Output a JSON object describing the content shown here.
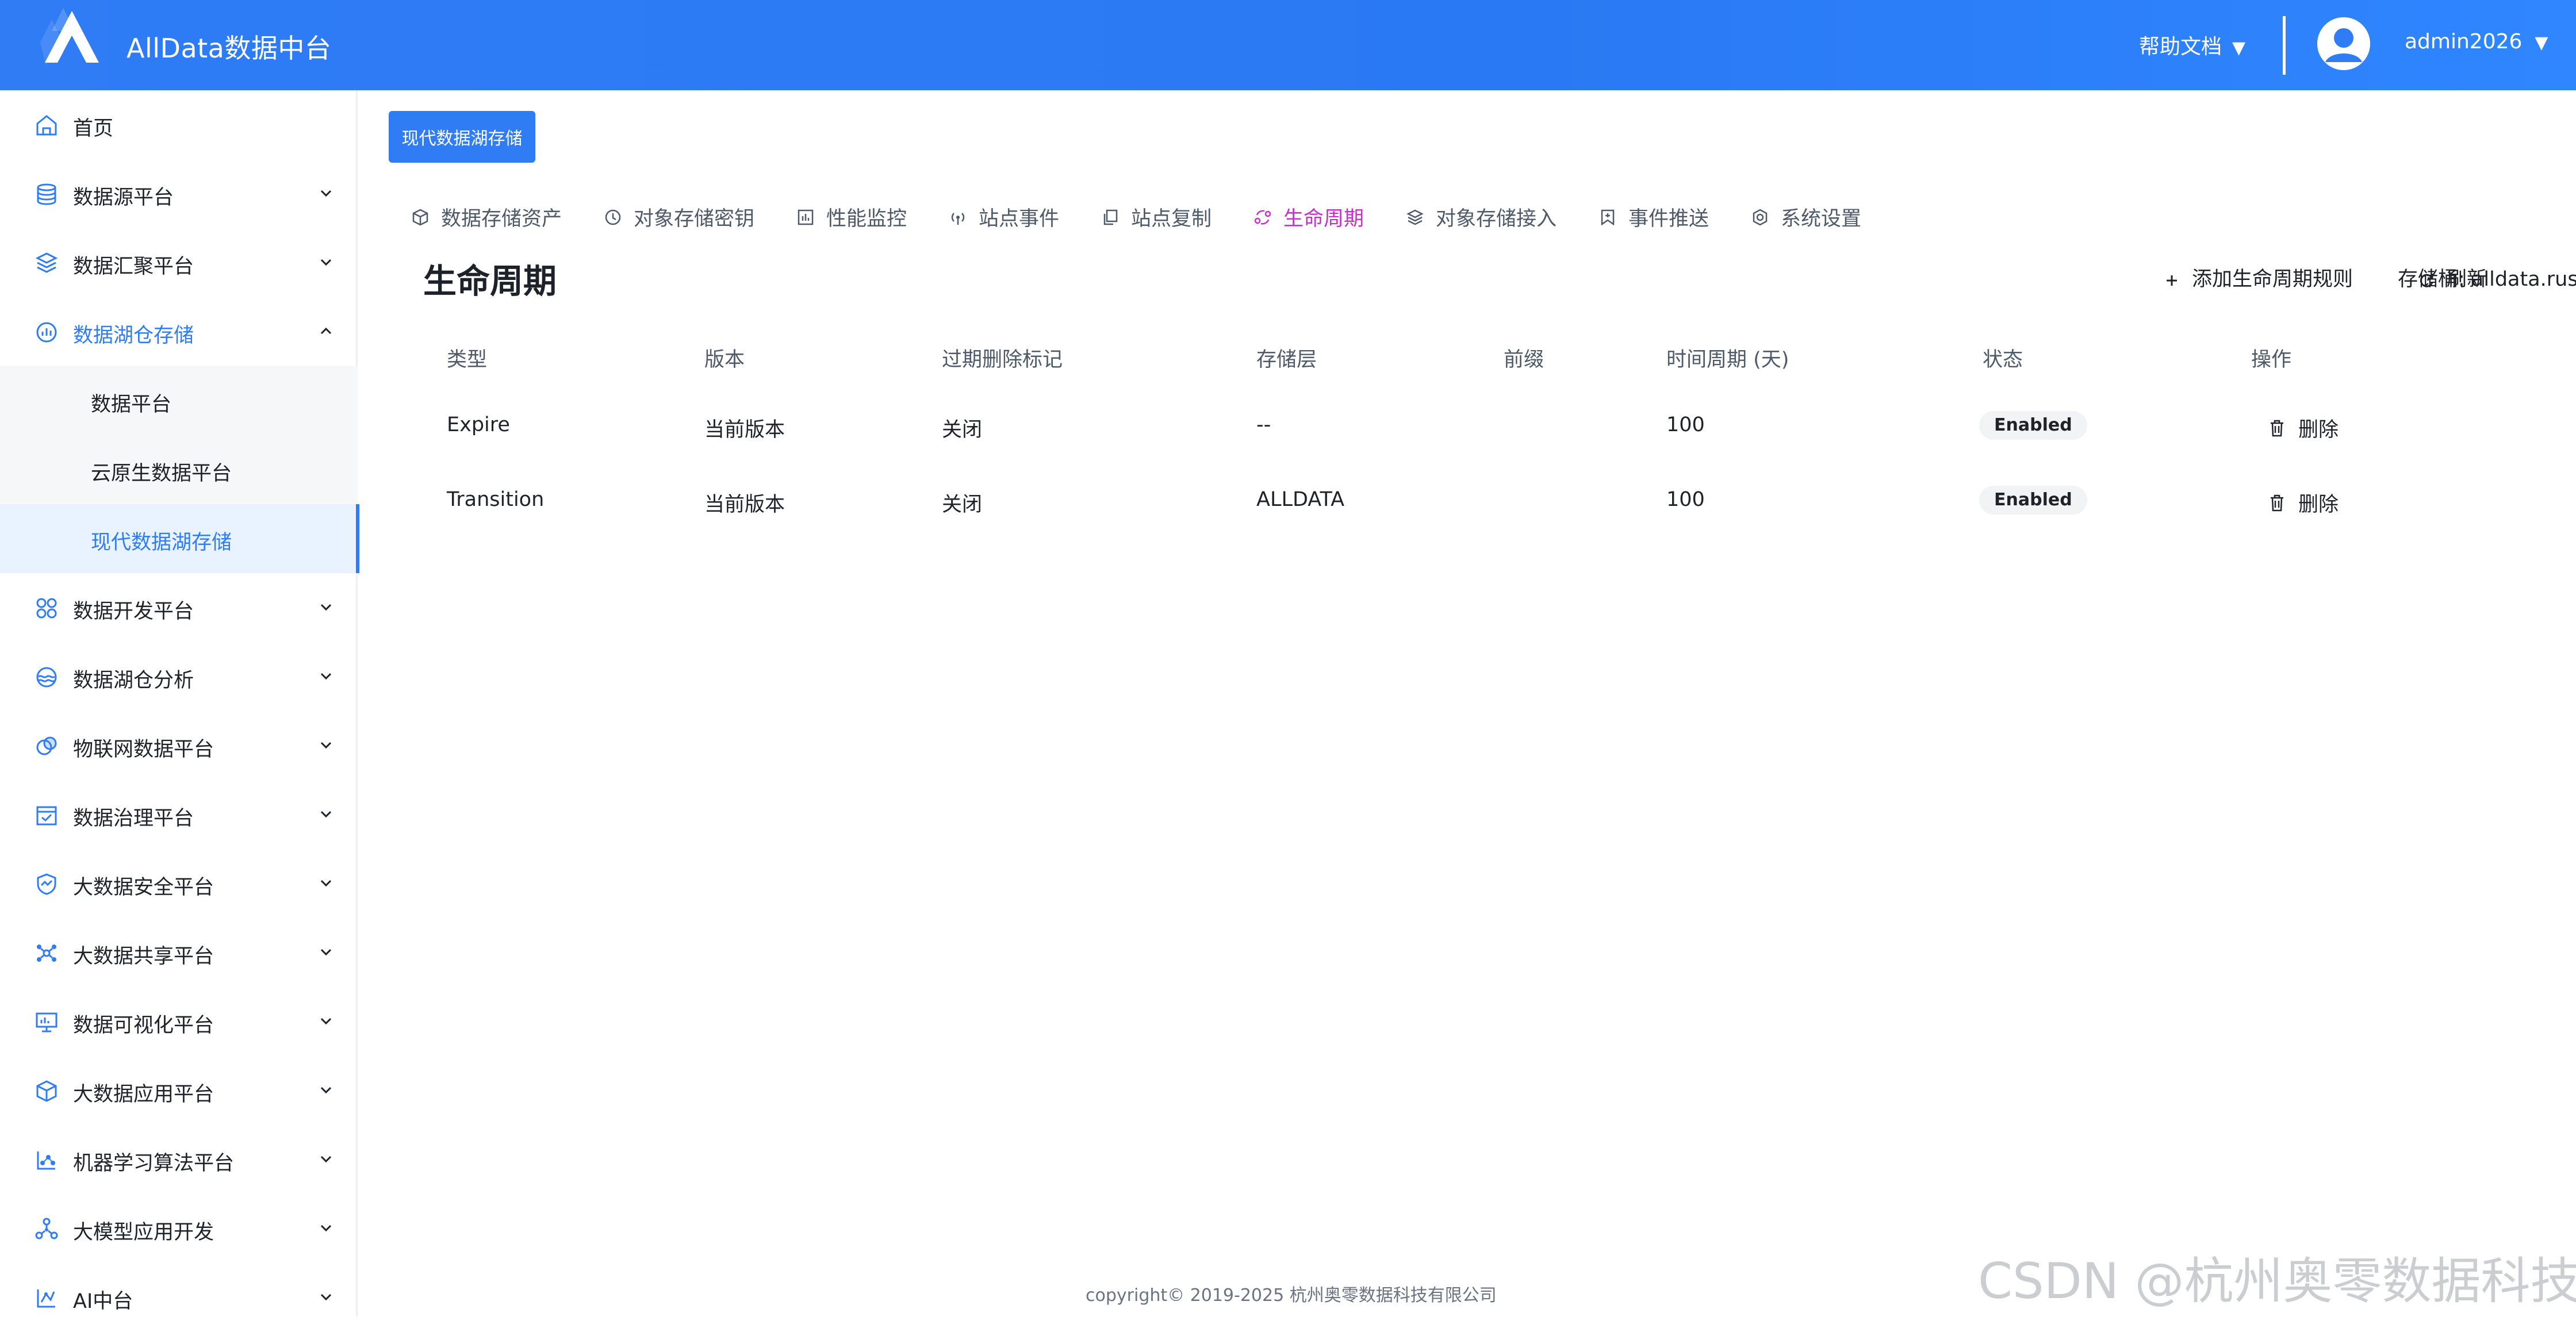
{
  "header": {
    "app_title": "AllData数据中台",
    "help_label": "帮助文档",
    "user_name": "admin2026",
    "caret": "▼"
  },
  "sidebar": {
    "items": [
      {
        "label": "首页",
        "icon": "home-icon"
      },
      {
        "label": "数据源平台",
        "icon": "database-icon"
      },
      {
        "label": "数据汇聚平台",
        "icon": "cube-stack-icon"
      },
      {
        "label": "数据湖仓存储",
        "icon": "chart-circle-icon"
      },
      {
        "label": "数据开发平台",
        "icon": "apps-icon"
      },
      {
        "label": "数据湖仓分析",
        "icon": "wave-icon"
      },
      {
        "label": "物联网数据平台",
        "icon": "iot-icon"
      },
      {
        "label": "数据治理平台",
        "icon": "calendar-check-icon"
      },
      {
        "label": "大数据安全平台",
        "icon": "shield-icon"
      },
      {
        "label": "大数据共享平台",
        "icon": "share-icon"
      },
      {
        "label": "数据可视化平台",
        "icon": "monitor-icon"
      },
      {
        "label": "大数据应用平台",
        "icon": "box-icon"
      },
      {
        "label": "机器学习算法平台",
        "icon": "ml-icon"
      },
      {
        "label": "大模型应用开发",
        "icon": "nodes-icon"
      },
      {
        "label": "AI中台",
        "icon": "ai-icon"
      }
    ],
    "sub_items": [
      {
        "label": "数据平台"
      },
      {
        "label": "云原生数据平台"
      },
      {
        "label": "现代数据湖存储"
      }
    ]
  },
  "main": {
    "breadcrumb_button": "现代数据湖存储",
    "tabs": [
      {
        "label": "数据存储资产",
        "icon": "cube-icon"
      },
      {
        "label": "对象存储密钥",
        "icon": "key-icon"
      },
      {
        "label": "性能监控",
        "icon": "bar-chart-icon"
      },
      {
        "label": "站点事件",
        "icon": "signal-icon"
      },
      {
        "label": "站点复制",
        "icon": "copy-icon"
      },
      {
        "label": "生命周期",
        "icon": "lifecycle-icon"
      },
      {
        "label": "对象存储接入",
        "icon": "layers-icon"
      },
      {
        "label": "事件推送",
        "icon": "bookmark-icon"
      },
      {
        "label": "系统设置",
        "icon": "settings-icon"
      }
    ],
    "page_title": "生命周期",
    "bucket_label": "存储桶: alldata.rustfs",
    "add_rule_label": "添加生命周期规则",
    "refresh_label": "刷新",
    "table": {
      "columns": [
        "类型",
        "版本",
        "过期删除标记",
        "存储层",
        "前缀",
        "时间周期 (天)",
        "状态",
        "操作"
      ],
      "rows": [
        {
          "type": "Expire",
          "version": "当前版本",
          "expired_marker": "关闭",
          "tier": "--",
          "prefix": "",
          "days": "100",
          "status": "Enabled",
          "action": "删除"
        },
        {
          "type": "Transition",
          "version": "当前版本",
          "expired_marker": "关闭",
          "tier": "ALLDATA",
          "prefix": "",
          "days": "100",
          "status": "Enabled",
          "action": "删除"
        }
      ]
    }
  },
  "footer": {
    "copyright": "copyright© 2019-2025 杭州奥零数据科技有限公司"
  },
  "watermark": "CSDN @杭州奥零数据科技"
}
